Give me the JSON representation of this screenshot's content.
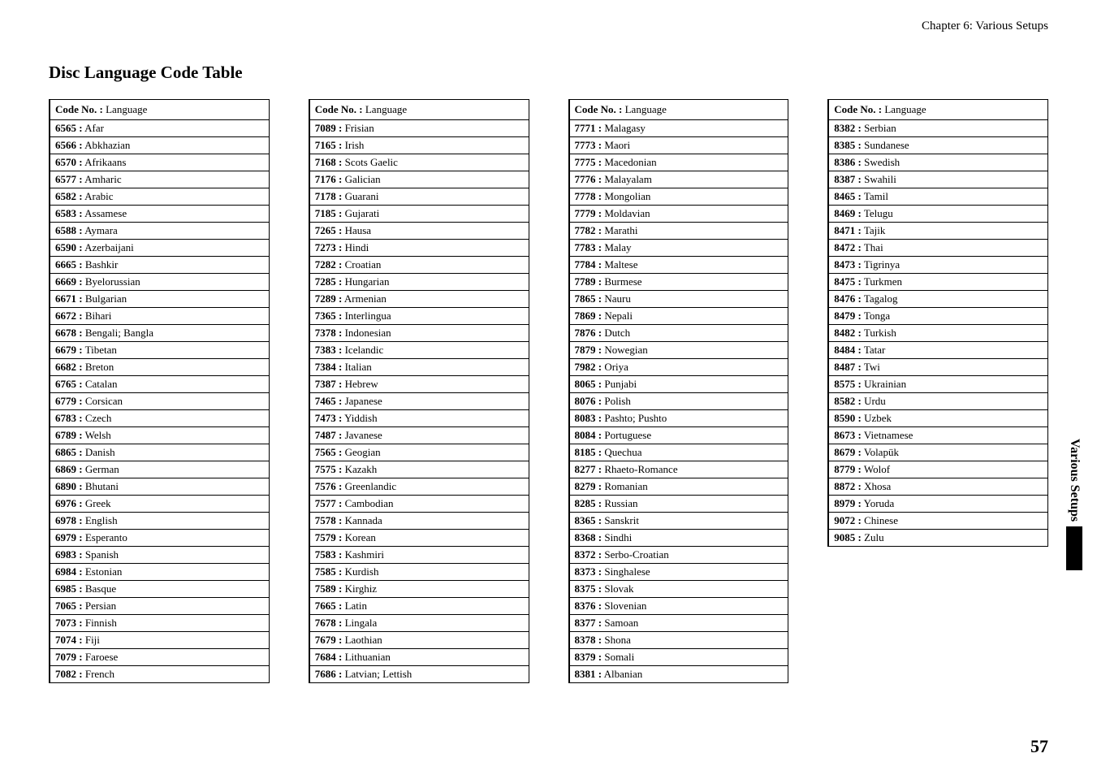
{
  "chapter": "Chapter 6: Various Setups",
  "title": "Disc Language Code Table",
  "header_bold": "Code No. :",
  "header_plain": " Language",
  "side_tab": "Various Setups",
  "page_number": "57",
  "columns": [
    [
      {
        "code": "6565 :",
        "lang": " Afar"
      },
      {
        "code": "6566 :",
        "lang": " Abkhazian"
      },
      {
        "code": "6570 :",
        "lang": " Afrikaans"
      },
      {
        "code": "6577 :",
        "lang": " Amharic"
      },
      {
        "code": "6582 :",
        "lang": " Arabic"
      },
      {
        "code": "6583 :",
        "lang": " Assamese"
      },
      {
        "code": "6588 :",
        "lang": " Aymara"
      },
      {
        "code": "6590 :",
        "lang": " Azerbaijani"
      },
      {
        "code": "6665 :",
        "lang": " Bashkir"
      },
      {
        "code": "6669  :",
        "lang": " Byelorussian"
      },
      {
        "code": "6671 :",
        "lang": " Bulgarian"
      },
      {
        "code": "6672 :",
        "lang": " Bihari"
      },
      {
        "code": "6678 :",
        "lang": " Bengali; Bangla"
      },
      {
        "code": "6679 :",
        "lang": " Tibetan"
      },
      {
        "code": "6682 :",
        "lang": " Breton"
      },
      {
        "code": "6765 :",
        "lang": " Catalan"
      },
      {
        "code": "6779 :",
        "lang": " Corsican"
      },
      {
        "code": "6783 :",
        "lang": " Czech"
      },
      {
        "code": "6789 :",
        "lang": " Welsh"
      },
      {
        "code": "6865 :",
        "lang": " Danish"
      },
      {
        "code": "6869 :",
        "lang": " German"
      },
      {
        "code": "6890 :",
        "lang": " Bhutani"
      },
      {
        "code": "6976 :",
        "lang": " Greek"
      },
      {
        "code": "6978 :",
        "lang": " English"
      },
      {
        "code": "6979 :",
        "lang": " Esperanto"
      },
      {
        "code": "6983 :",
        "lang": " Spanish"
      },
      {
        "code": "6984 :",
        "lang": " Estonian"
      },
      {
        "code": "6985 :",
        "lang": " Basque"
      },
      {
        "code": "7065 :",
        "lang": " Persian"
      },
      {
        "code": "7073 :",
        "lang": " Finnish"
      },
      {
        "code": "7074 :",
        "lang": " Fiji"
      },
      {
        "code": "7079 :",
        "lang": " Faroese"
      },
      {
        "code": "7082 :",
        "lang": " French"
      }
    ],
    [
      {
        "code": "7089 :",
        "lang": " Frisian"
      },
      {
        "code": "7165 :",
        "lang": " Irish"
      },
      {
        "code": "7168 :",
        "lang": " Scots Gaelic"
      },
      {
        "code": "7176 :",
        "lang": " Galician"
      },
      {
        "code": "7178 :",
        "lang": " Guarani"
      },
      {
        "code": "7185 :",
        "lang": " Gujarati"
      },
      {
        "code": "7265 :",
        "lang": " Hausa"
      },
      {
        "code": "7273 :",
        "lang": " Hindi"
      },
      {
        "code": "7282 :",
        "lang": " Croatian"
      },
      {
        "code": "7285 :",
        "lang": " Hungarian"
      },
      {
        "code": "7289 :",
        "lang": " Armenian"
      },
      {
        "code": "7365 :",
        "lang": " Interlingua"
      },
      {
        "code": "7378 :",
        "lang": " Indonesian"
      },
      {
        "code": "7383 :",
        "lang": " Icelandic"
      },
      {
        "code": "7384 :",
        "lang": " Italian"
      },
      {
        "code": "7387 :",
        "lang": " Hebrew"
      },
      {
        "code": "7465 :",
        "lang": " Japanese"
      },
      {
        "code": "7473 :",
        "lang": " Yiddish"
      },
      {
        "code": "7487 :",
        "lang": " Javanese"
      },
      {
        "code": "7565 :",
        "lang": " Geogian"
      },
      {
        "code": "7575 :",
        "lang": " Kazakh"
      },
      {
        "code": "7576 :",
        "lang": " Greenlandic"
      },
      {
        "code": "7577 :",
        "lang": " Cambodian"
      },
      {
        "code": "7578 :",
        "lang": " Kannada"
      },
      {
        "code": "7579 :",
        "lang": " Korean"
      },
      {
        "code": "7583 :",
        "lang": " Kashmiri"
      },
      {
        "code": "7585 :",
        "lang": " Kurdish"
      },
      {
        "code": "7589 :",
        "lang": " Kirghiz"
      },
      {
        "code": "7665 :",
        "lang": " Latin"
      },
      {
        "code": "7678 :",
        "lang": " Lingala"
      },
      {
        "code": "7679 :",
        "lang": " Laothian"
      },
      {
        "code": "7684 :",
        "lang": " Lithuanian"
      },
      {
        "code": "7686  :",
        "lang": " Latvian; Lettish"
      }
    ],
    [
      {
        "code": "7771 :",
        "lang": " Malagasy"
      },
      {
        "code": "7773 :",
        "lang": " Maori"
      },
      {
        "code": "7775 :",
        "lang": " Macedonian"
      },
      {
        "code": "7776 :",
        "lang": " Malayalam"
      },
      {
        "code": "7778 :",
        "lang": " Mongolian"
      },
      {
        "code": "7779 :",
        "lang": " Moldavian"
      },
      {
        "code": "7782 :",
        "lang": " Marathi"
      },
      {
        "code": "7783 :",
        "lang": " Malay"
      },
      {
        "code": "7784 :",
        "lang": " Maltese"
      },
      {
        "code": "7789 :",
        "lang": " Burmese"
      },
      {
        "code": "7865 :",
        "lang": " Nauru"
      },
      {
        "code": "7869 :",
        "lang": " Nepali"
      },
      {
        "code": "7876 :",
        "lang": " Dutch"
      },
      {
        "code": "7879 :",
        "lang": " Nowegian"
      },
      {
        "code": "7982 :",
        "lang": " Oriya"
      },
      {
        "code": "8065 :",
        "lang": " Punjabi"
      },
      {
        "code": "8076 :",
        "lang": " Polish"
      },
      {
        "code": "8083 :",
        "lang": " Pashto; Pushto"
      },
      {
        "code": "8084 :",
        "lang": " Portuguese"
      },
      {
        "code": "8185 :",
        "lang": " Quechua"
      },
      {
        "code": "8277 :",
        "lang": " Rhaeto-Romance"
      },
      {
        "code": "8279 :",
        "lang": " Romanian"
      },
      {
        "code": "8285 :",
        "lang": " Russian"
      },
      {
        "code": "8365 :",
        "lang": " Sanskrit"
      },
      {
        "code": "8368 :",
        "lang": " Sindhi"
      },
      {
        "code": "8372 :",
        "lang": " Serbo-Croatian"
      },
      {
        "code": "8373 :",
        "lang": " Singhalese"
      },
      {
        "code": "8375 :",
        "lang": " Slovak"
      },
      {
        "code": "8376 :",
        "lang": " Slovenian"
      },
      {
        "code": "8377 :",
        "lang": " Samoan"
      },
      {
        "code": "8378 :",
        "lang": " Shona"
      },
      {
        "code": "8379 :",
        "lang": " Somali"
      },
      {
        "code": "8381 :",
        "lang": " Albanian"
      }
    ],
    [
      {
        "code": "8382 :",
        "lang": " Serbian"
      },
      {
        "code": "8385 :",
        "lang": " Sundanese"
      },
      {
        "code": "8386 :",
        "lang": " Swedish"
      },
      {
        "code": "8387 :",
        "lang": " Swahili"
      },
      {
        "code": "8465 :",
        "lang": " Tamil"
      },
      {
        "code": "8469 :",
        "lang": " Telugu"
      },
      {
        "code": "8471 :",
        "lang": " Tajik"
      },
      {
        "code": "8472 :",
        "lang": " Thai"
      },
      {
        "code": "8473 :",
        "lang": " Tigrinya"
      },
      {
        "code": "8475 :",
        "lang": " Turkmen"
      },
      {
        "code": "8476 :",
        "lang": " Tagalog"
      },
      {
        "code": "8479 :",
        "lang": " Tonga"
      },
      {
        "code": "8482 :",
        "lang": " Turkish"
      },
      {
        "code": "8484 :",
        "lang": " Tatar"
      },
      {
        "code": "8487 :",
        "lang": " Twi"
      },
      {
        "code": "8575 :",
        "lang": " Ukrainian"
      },
      {
        "code": "8582 :",
        "lang": " Urdu"
      },
      {
        "code": "8590 :",
        "lang": " Uzbek"
      },
      {
        "code": "8673 :",
        "lang": " Vietnamese"
      },
      {
        "code": "8679 :",
        "lang": " Volapük"
      },
      {
        "code": "8779 :",
        "lang": " Wolof"
      },
      {
        "code": "8872 :",
        "lang": " Xhosa"
      },
      {
        "code": "8979 :",
        "lang": " Yoruda"
      },
      {
        "code": "9072 :",
        "lang": " Chinese"
      },
      {
        "code": "9085 :",
        "lang": " Zulu"
      }
    ]
  ]
}
